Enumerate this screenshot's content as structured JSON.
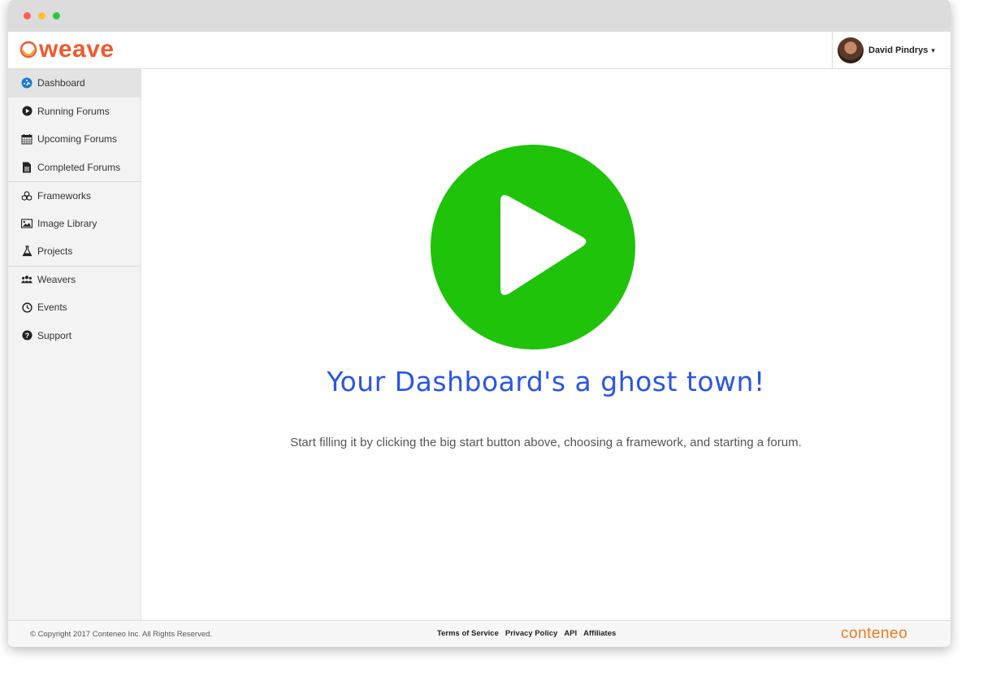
{
  "app": {
    "logo_text": "weave",
    "brand_color": "#ee5b2e"
  },
  "user": {
    "name": "David Pindrys",
    "caret": "▾"
  },
  "sidebar": {
    "items": [
      {
        "label": "Dashboard",
        "icon": "dashboard-icon",
        "active": true
      },
      {
        "label": "Running Forums",
        "icon": "play-circle-icon"
      },
      {
        "label": "Upcoming Forums",
        "icon": "calendar-icon"
      },
      {
        "label": "Completed Forums",
        "icon": "document-icon"
      },
      {
        "label": "Frameworks",
        "icon": "cubes-icon"
      },
      {
        "label": "Image Library",
        "icon": "image-icon"
      },
      {
        "label": "Projects",
        "icon": "flask-icon"
      },
      {
        "label": "Weavers",
        "icon": "users-icon"
      },
      {
        "label": "Events",
        "icon": "clock-icon"
      },
      {
        "label": "Support",
        "icon": "question-circle-icon"
      }
    ]
  },
  "main": {
    "play_color": "#1fc30a",
    "headline": "Your Dashboard's a ghost town!",
    "headline_color": "#2a55e6",
    "subline": "Start filling it by clicking the big start button above, choosing a framework, and starting a forum."
  },
  "footer": {
    "copyright": "© Copyright 2017 Conteneo Inc. All Rights Reserved.",
    "links": [
      "Terms of Service",
      "Privacy Policy",
      "API",
      "Affiliates"
    ],
    "brand": "conteneo",
    "brand_color": "#ee7a1e"
  }
}
